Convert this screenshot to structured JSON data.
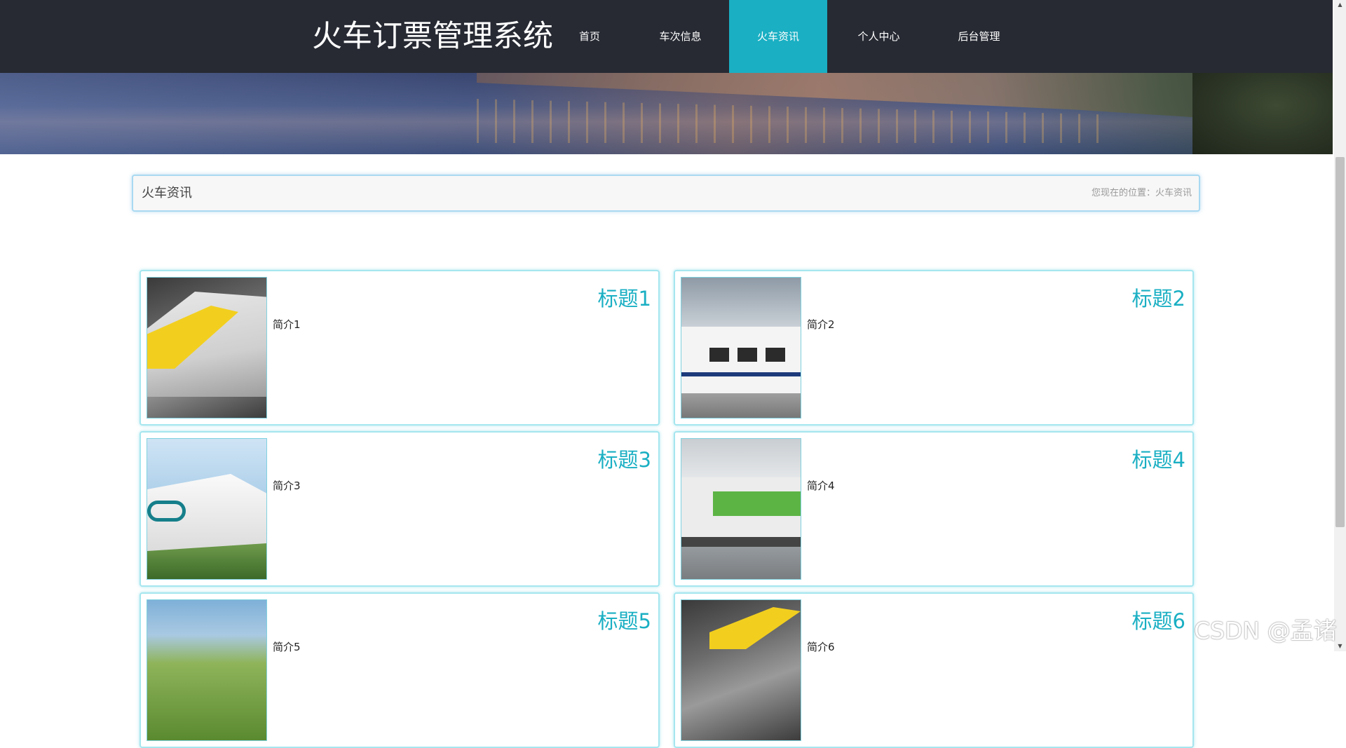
{
  "header": {
    "brand": "火车订票管理系统",
    "nav": [
      {
        "label": "首页",
        "active": false
      },
      {
        "label": "车次信息",
        "active": false
      },
      {
        "label": "火车资讯",
        "active": true
      },
      {
        "label": "个人中心",
        "active": false
      },
      {
        "label": "后台管理",
        "active": false
      }
    ]
  },
  "breadcrumb": {
    "title": "火车资讯",
    "location_prefix": "您现在的位置：",
    "location": "火车资讯"
  },
  "news": [
    {
      "title": "标题1",
      "intro": "简介1",
      "image": "train-yellow"
    },
    {
      "title": "标题2",
      "intro": "简介2",
      "image": "train-station-white"
    },
    {
      "title": "标题3",
      "intro": "简介3",
      "image": "train-white-teal"
    },
    {
      "title": "标题4",
      "intro": "简介4",
      "image": "train-green"
    },
    {
      "title": "标题5",
      "intro": "简介5",
      "image": "train-countryside"
    },
    {
      "title": "标题6",
      "intro": "简介6",
      "image": "train-yellow"
    }
  ],
  "watermark": "CSDN @孟诸",
  "colors": {
    "nav_bg": "#272a33",
    "accent": "#1aafc3",
    "panel_border": "#a9d9f1",
    "card_border": "#a6e6ef"
  }
}
